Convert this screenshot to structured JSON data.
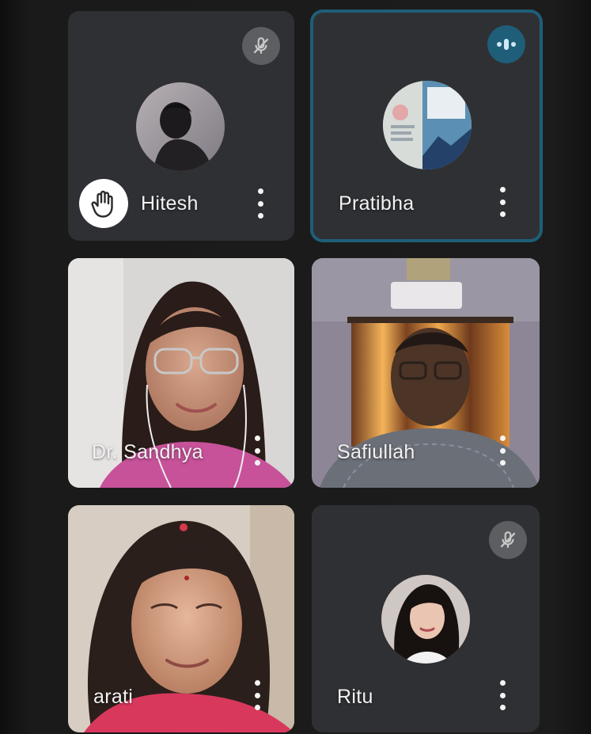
{
  "participants": [
    {
      "name": "Hitesh",
      "hand_raised": true,
      "muted": true
    },
    {
      "name": "Pratibha",
      "speaking": true
    },
    {
      "name": "Dr. Sandhya",
      "camera": "on"
    },
    {
      "name": "Safiullah",
      "camera": "on"
    },
    {
      "name": "arati",
      "camera": "on"
    },
    {
      "name": "Ritu",
      "muted": true
    }
  ],
  "icons": {
    "mute": "mic-off-icon",
    "speaking": "audio-level-icon",
    "hand": "raised-hand-icon",
    "more": "more-vert-icon"
  },
  "colors": {
    "tile_bg": "#2f3034",
    "speaking_accent": "#1e5e78",
    "mute_badge": "#5d5e62",
    "background": "#151515"
  }
}
